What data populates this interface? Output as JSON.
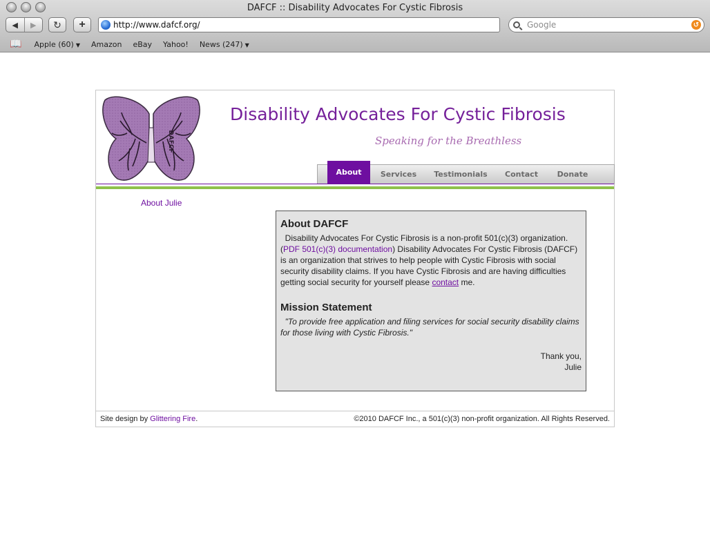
{
  "browser": {
    "window_title": "DAFCF :: Disability Advocates For Cystic Fibrosis",
    "url": "http://www.dafcf.org/",
    "search_placeholder": "Google",
    "bookmarks": [
      {
        "label": "Apple (60)",
        "has_menu": true
      },
      {
        "label": "Amazon",
        "has_menu": false
      },
      {
        "label": "eBay",
        "has_menu": false
      },
      {
        "label": "Yahoo!",
        "has_menu": false
      },
      {
        "label": "News (247)",
        "has_menu": true
      }
    ]
  },
  "site": {
    "logo_text": "DAFCF",
    "title": "Disability Advocates For Cystic Fibrosis",
    "tagline": "Speaking for the Breathless",
    "accent_color": "#6e0fa0",
    "green_color": "#8fc14c",
    "nav": [
      "About",
      "Services",
      "Testimonials",
      "Contact",
      "Donate"
    ],
    "active_nav": "About",
    "side_link": "About Julie"
  },
  "content": {
    "heading": "About DAFCF",
    "para_lead": "Disability Advocates For Cystic Fibrosis is a non-profit 501(c)(3) organization.",
    "pdf_link": "PDF 501(c)(3) documentation",
    "para_rest": "Disability Advocates For Cystic Fibrosis (DAFCF) is an organization that strives to help people with Cystic Fibrosis with social security disability claims. If you have Cystic Fibrosis and are having difficulties getting social security for yourself please",
    "contact_link": "contact",
    "para_end": "me.",
    "mission_heading": "Mission Statement",
    "mission_quote": "\"To provide free application and filing services for social security disability claims for those living with Cystic Fibrosis.\"",
    "thanks": "Thank you,",
    "signature": "Julie"
  },
  "footer": {
    "design_prefix": "Site design by",
    "designer_link": "Glittering Fire",
    "copyright": "©2010 DAFCF Inc., a 501(c)(3) non-profit organization. All Rights Reserved."
  }
}
